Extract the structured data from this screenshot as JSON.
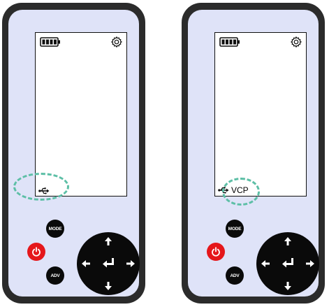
{
  "devices": [
    {
      "id": "left",
      "buttons": {
        "mode": "MODE",
        "adv": "ADV"
      },
      "status": {
        "connection_label": ""
      }
    },
    {
      "id": "right",
      "buttons": {
        "mode": "MODE",
        "adv": "ADV"
      },
      "status": {
        "connection_label": "VCP"
      }
    }
  ],
  "colors": {
    "body": "#2b2b2b",
    "panel": "#dfe3f8",
    "power": "#e5171b",
    "highlight": "#5dbfa6"
  },
  "icons": [
    "battery-icon",
    "gear-icon",
    "usb-icon",
    "power-icon",
    "arrow-up-icon",
    "arrow-down-icon",
    "arrow-left-icon",
    "arrow-right-icon",
    "enter-icon"
  ]
}
